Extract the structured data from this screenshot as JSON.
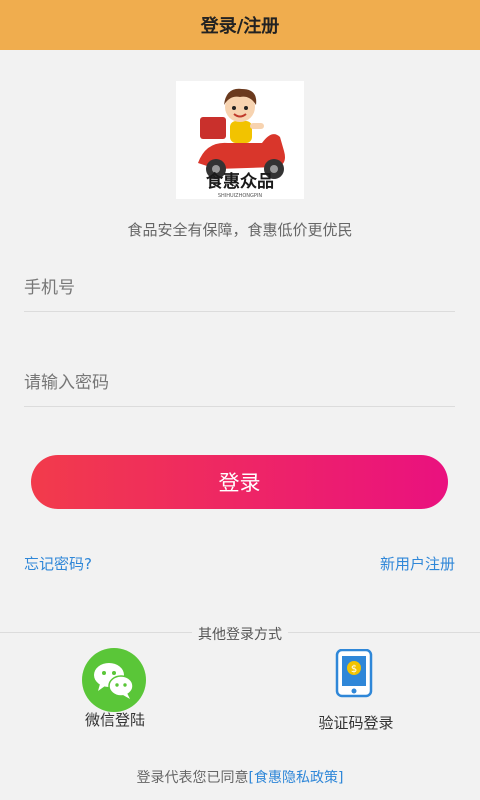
{
  "header": {
    "title": "登录/注册"
  },
  "logo": {
    "brand_text": "食惠众品",
    "brand_sub": "SHIHUIZHONGPIN"
  },
  "slogan": "食品安全有保障，食惠低价更优民",
  "form": {
    "phone_placeholder": "手机号",
    "password_placeholder": "请输入密码",
    "login_label": "登录"
  },
  "links": {
    "forgot": "忘记密码?",
    "register": "新用户注册"
  },
  "other_login": {
    "title": "其他登录方式",
    "wechat_label": "微信登陆",
    "sms_label": "验证码登录"
  },
  "agreement": {
    "prefix": "登录代表您已同意",
    "policy": "[食惠隐私政策]"
  },
  "colors": {
    "header_bg": "#f0ad4e",
    "button_start": "#f23b4b",
    "button_end": "#ea117f",
    "link": "#2f87d8",
    "wechat": "#5ac638"
  }
}
